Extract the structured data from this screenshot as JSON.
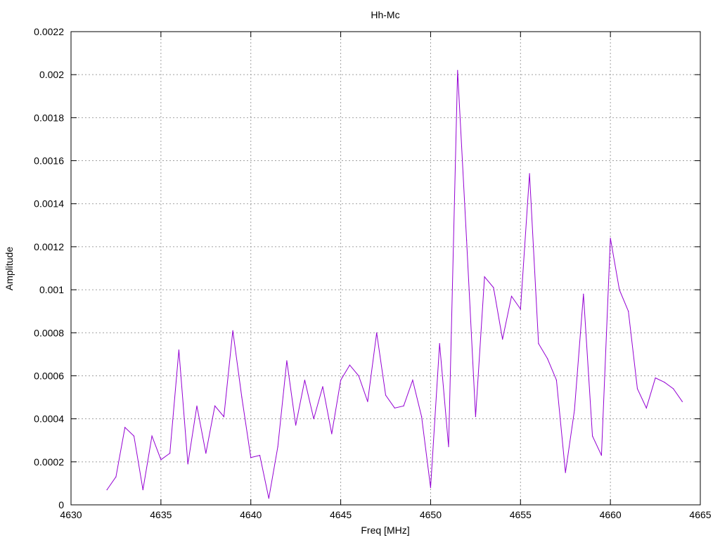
{
  "chart_data": {
    "type": "line",
    "title": "Hh-Mc",
    "xlabel": "Freq [MHz]",
    "ylabel": "Amplitude",
    "xlim": [
      4630,
      4665
    ],
    "ylim": [
      0,
      0.0022
    ],
    "x_ticks": [
      "4630",
      "4635",
      "4640",
      "4645",
      "4650",
      "4655",
      "4660",
      "4665"
    ],
    "y_ticks": [
      "0",
      "0.0002",
      "0.0004",
      "0.0006",
      "0.0008",
      "0.001",
      "0.0012",
      "0.0014",
      "0.0016",
      "0.0018",
      "0.002",
      "0.0022"
    ],
    "grid": true,
    "legend": "none",
    "colors": {
      "series": "#9400d3",
      "grid": "#a0a0a0",
      "axis": "#000000"
    },
    "series": [
      {
        "x": [
          4632.0,
          4632.5,
          4633.0,
          4633.5,
          4634.0,
          4634.5,
          4635.0,
          4635.5,
          4636.0,
          4636.5,
          4637.0,
          4637.5,
          4638.0,
          4638.5,
          4639.0,
          4639.5,
          4640.0,
          4640.5,
          4641.0,
          4641.5,
          4642.0,
          4642.5,
          4643.0,
          4643.5,
          4644.0,
          4644.5,
          4645.0,
          4645.5,
          4646.0,
          4646.5,
          4647.0,
          4647.5,
          4648.0,
          4648.5,
          4649.0,
          4649.5,
          4650.0,
          4650.5,
          4651.0,
          4651.5,
          4652.0,
          4652.5,
          4653.0,
          4653.5,
          4654.0,
          4654.5,
          4655.0,
          4655.5,
          4656.0,
          4656.5,
          4657.0,
          4657.5,
          4658.0,
          4658.5,
          4659.0,
          4659.5,
          4660.0,
          4660.5,
          4661.0,
          4661.5,
          4662.0,
          4662.5,
          4663.0,
          4663.5,
          4664.0
        ],
        "y": [
          7e-05,
          0.00013,
          0.00036,
          0.00032,
          7e-05,
          0.00032,
          0.00021,
          0.00024,
          0.00072,
          0.00019,
          0.00046,
          0.00024,
          0.00046,
          0.00041,
          0.00081,
          0.0005,
          0.00022,
          0.00023,
          3e-05,
          0.00027,
          0.00067,
          0.00037,
          0.00058,
          0.0004,
          0.00055,
          0.00033,
          0.00058,
          0.00065,
          0.0006,
          0.00048,
          0.0008,
          0.00051,
          0.00045,
          0.00046,
          0.00058,
          0.00041,
          8e-05,
          0.00075,
          0.00027,
          0.00202,
          0.00123,
          0.00041,
          0.00106,
          0.00101,
          0.00077,
          0.00097,
          0.00091,
          0.00154,
          0.00075,
          0.00068,
          0.00058,
          0.00015,
          0.00044,
          0.00098,
          0.00032,
          0.00023,
          0.00124,
          0.001,
          0.0009,
          0.00054,
          0.00045,
          0.00059,
          0.00057,
          0.00054,
          0.00048
        ]
      }
    ]
  }
}
